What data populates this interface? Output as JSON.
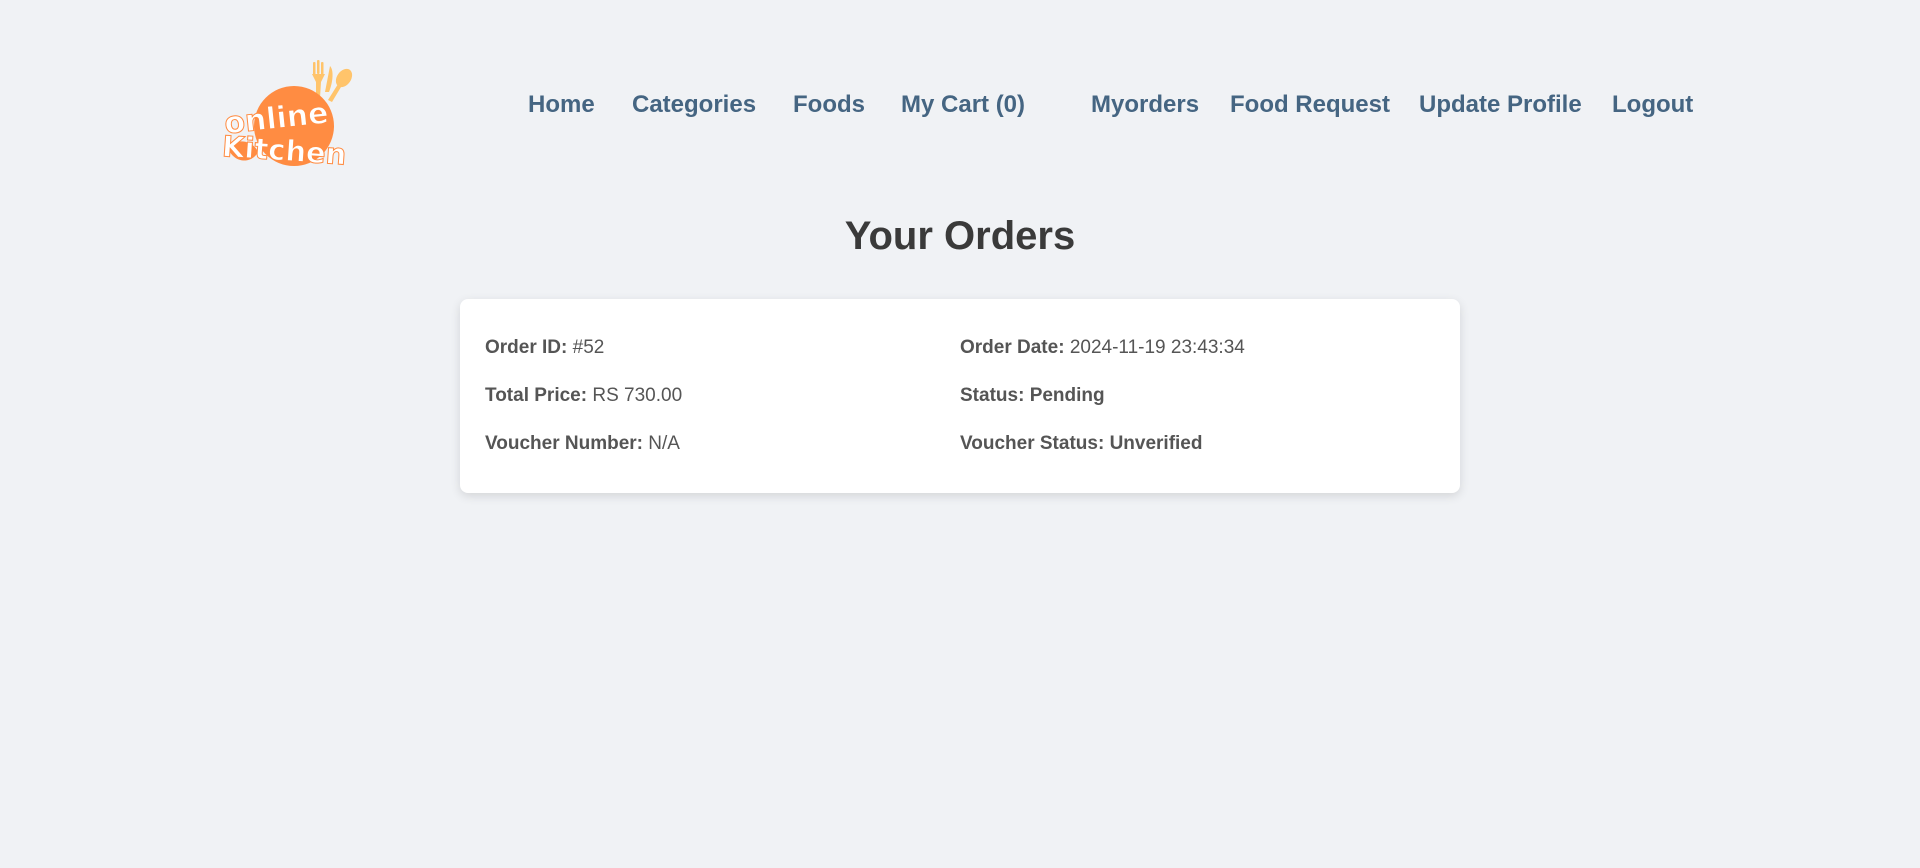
{
  "brand": {
    "logo_line1": "online",
    "logo_line2": "Kitchen",
    "logo_color": "#ff8c42"
  },
  "nav": {
    "items": [
      {
        "label": "Home"
      },
      {
        "label": "Categories"
      },
      {
        "label": "Foods"
      },
      {
        "label": "My Cart (0)"
      },
      {
        "label": "Myorders"
      },
      {
        "label": "Food Request"
      },
      {
        "label": "Update Profile"
      },
      {
        "label": "Logout"
      }
    ],
    "color": "#456582"
  },
  "page": {
    "title": "Your Orders"
  },
  "order": {
    "id_label": "Order ID:",
    "id_value": "#52",
    "date_label": "Order Date:",
    "date_value": "2024-11-19 23:43:34",
    "price_label": "Total Price:",
    "price_value": "RS 730.00",
    "status_label": "Status:",
    "status_value": "Pending",
    "voucher_number_label": "Voucher Number:",
    "voucher_number_value": "N/A",
    "voucher_status_label": "Voucher Status:",
    "voucher_status_value": "Unverified"
  }
}
